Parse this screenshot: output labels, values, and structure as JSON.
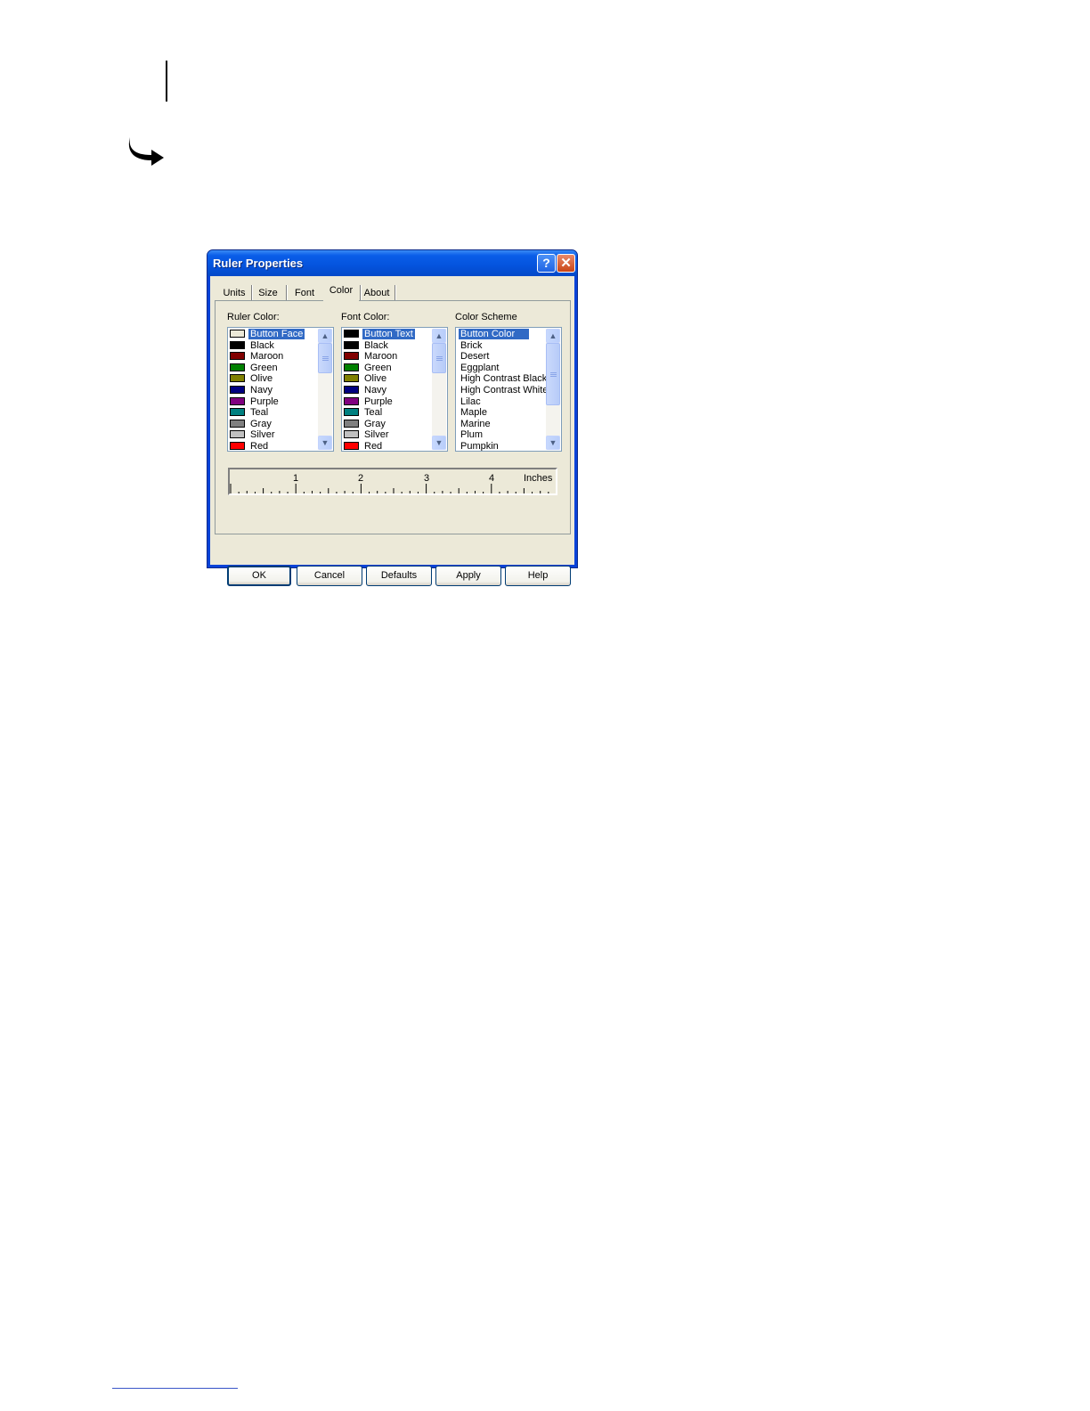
{
  "dialog": {
    "title": "Ruler Properties",
    "help_button": "?",
    "close_button": "✕",
    "tabs": [
      {
        "label": "Units"
      },
      {
        "label": "Size"
      },
      {
        "label": "Font"
      },
      {
        "label": "Color",
        "active": true
      },
      {
        "label": "About"
      }
    ],
    "ruler_color": {
      "label": "Ruler Color:",
      "selected": "Button Face",
      "items": [
        {
          "label": "Button Face",
          "color": "#ece9d8"
        },
        {
          "label": "Black",
          "color": "#000000"
        },
        {
          "label": "Maroon",
          "color": "#800000"
        },
        {
          "label": "Green",
          "color": "#008000"
        },
        {
          "label": "Olive",
          "color": "#808000"
        },
        {
          "label": "Navy",
          "color": "#000080"
        },
        {
          "label": "Purple",
          "color": "#800080"
        },
        {
          "label": "Teal",
          "color": "#008080"
        },
        {
          "label": "Gray",
          "color": "#808080"
        },
        {
          "label": "Silver",
          "color": "#c0c0c0"
        },
        {
          "label": "Red",
          "color": "#ff0000"
        }
      ]
    },
    "font_color": {
      "label": "Font Color:",
      "selected": "Button Text",
      "items": [
        {
          "label": "Button Text",
          "color": "#000000"
        },
        {
          "label": "Black",
          "color": "#000000"
        },
        {
          "label": "Maroon",
          "color": "#800000"
        },
        {
          "label": "Green",
          "color": "#008000"
        },
        {
          "label": "Olive",
          "color": "#808000"
        },
        {
          "label": "Navy",
          "color": "#000080"
        },
        {
          "label": "Purple",
          "color": "#800080"
        },
        {
          "label": "Teal",
          "color": "#008080"
        },
        {
          "label": "Gray",
          "color": "#808080"
        },
        {
          "label": "Silver",
          "color": "#c0c0c0"
        },
        {
          "label": "Red",
          "color": "#ff0000"
        }
      ]
    },
    "color_scheme": {
      "label": "Color Scheme",
      "selected": "Button Color",
      "items": [
        "Button Color",
        "Brick",
        "Desert",
        "Eggplant",
        "High Contrast Black",
        "High Contrast White",
        "Lilac",
        "Maple",
        "Marine",
        "Plum",
        "Pumpkin"
      ]
    },
    "ruler_preview": {
      "numbers": [
        "1",
        "2",
        "3",
        "4"
      ],
      "units": "Inches"
    },
    "buttons": {
      "ok": "OK",
      "cancel": "Cancel",
      "defaults": "Defaults",
      "apply": "Apply",
      "help": "Help"
    }
  },
  "colors": {
    "titlebar": "#0453dd",
    "dialog_face": "#ece9d8",
    "selection": "#316ac5",
    "footer_rule": "#3a56c8"
  }
}
